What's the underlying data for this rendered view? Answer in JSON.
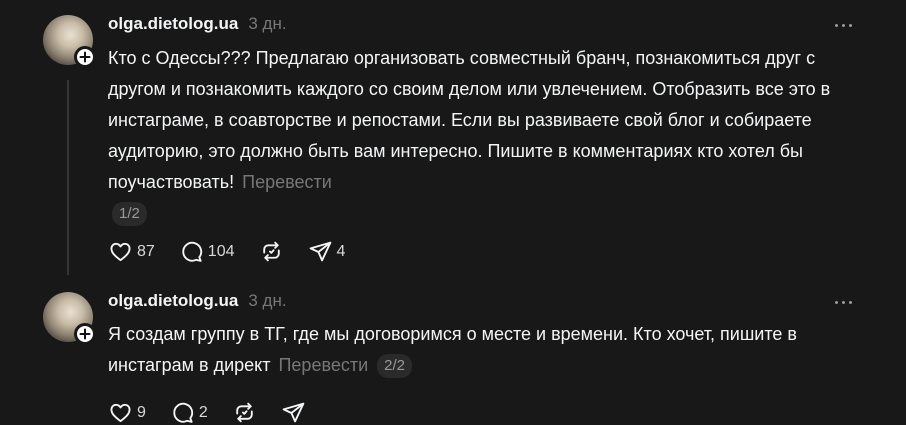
{
  "posts": [
    {
      "username": "olga.dietolog.ua",
      "time": "3 дн.",
      "text": "Кто с Одессы??? Предлагаю организовать совместный бранч, познакомиться друг с другом и познакомить каждого со своим делом или увлечением. Отобразить все это в инстаграме, в соавторстве и репостами. Если вы развиваете свой блог и собираете аудиторию, это должно быть вам интересно. Пишите в комментариях кто хотел бы поучаствовать!",
      "translate_label": "Перевести",
      "page_indicator": "1/2",
      "likes": "87",
      "comments": "104",
      "shares": "4"
    },
    {
      "username": "olga.dietolog.ua",
      "time": "3 дн.",
      "text": "Я создам группу в ТГ, где мы договоримся о месте и времени. Кто хочет, пишите в инстаграм в директ",
      "translate_label": "Перевести",
      "page_indicator": "2/2",
      "likes": "9",
      "comments": "2",
      "shares": ""
    }
  ],
  "icons": {
    "like": "heart-icon",
    "comment": "speech-bubble-icon",
    "repost": "repost-icon",
    "share": "paper-plane-icon",
    "more": "more-horizontal-icon",
    "follow": "plus-icon"
  }
}
